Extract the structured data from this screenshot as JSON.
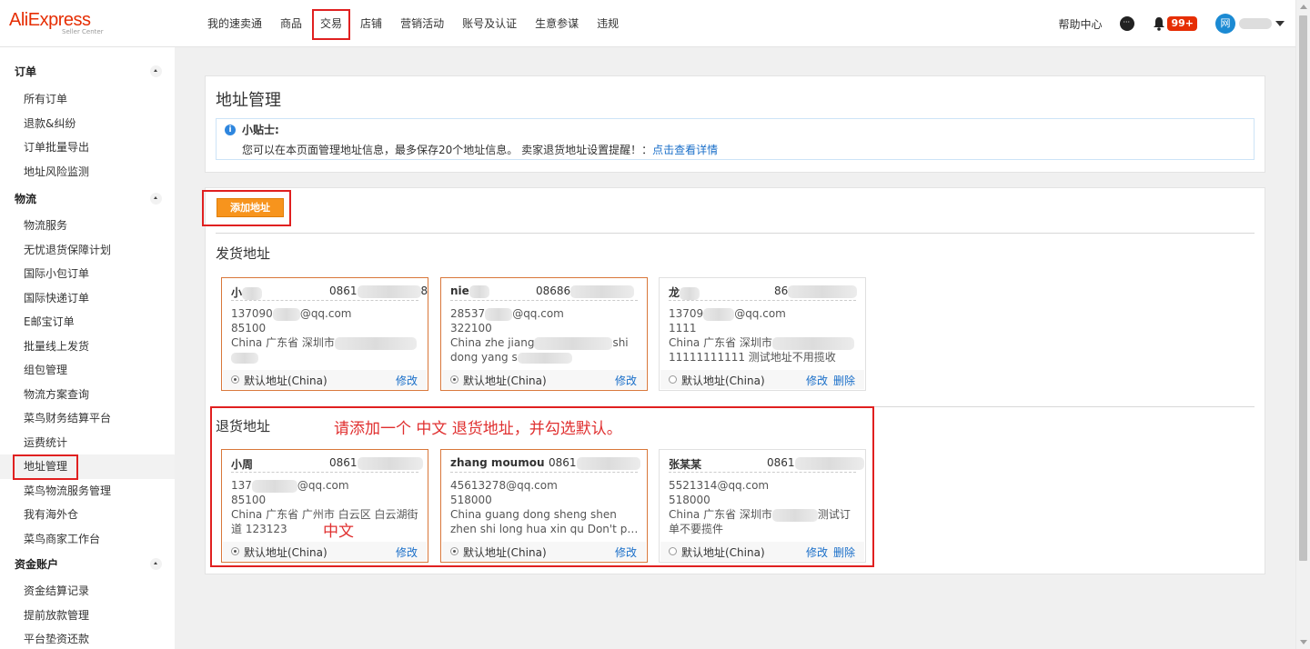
{
  "logo": {
    "brand": "AliExpress",
    "sub": "Seller Center"
  },
  "nav": {
    "items": [
      "我的速卖通",
      "商品",
      "交易",
      "店铺",
      "营销活动",
      "账号及认证",
      "生意参谋",
      "违规"
    ],
    "active_index": 2
  },
  "topright": {
    "help": "帮助中心",
    "badge": "99+",
    "avatar_initial": "网"
  },
  "sidebar": {
    "groups": [
      {
        "title": "订单",
        "items": [
          "所有订单",
          "退款&纠纷",
          "订单批量导出",
          "地址风险监测"
        ]
      },
      {
        "title": "物流",
        "items": [
          "物流服务",
          "无忧退货保障计划",
          "国际小包订单",
          "国际快递订单",
          "E邮宝订单",
          "批量线上发货",
          "组包管理",
          "物流方案查询",
          "菜鸟财务结算平台",
          "运费统计",
          "地址管理",
          "菜鸟物流服务管理",
          "我有海外仓",
          "菜鸟商家工作台"
        ]
      },
      {
        "title": "资金账户",
        "items": [
          "资金结算记录",
          "提前放款管理",
          "平台垫资还款"
        ]
      }
    ],
    "active_item": "地址管理"
  },
  "page": {
    "title": "地址管理",
    "tips_title": "小贴士:",
    "tips_text": "您可以在本页面管理地址信息，最多保存20个地址信息。 卖家退货地址设置提醒！：",
    "tips_link": "点击查看详情",
    "add_button": "添加地址",
    "ship_title": "发货地址",
    "return_title": "退货地址"
  },
  "ship_cards": [
    {
      "name": "小",
      "phone_prefix": "0861",
      "phone_suffix": "8",
      "email_prefix": "137090",
      "email_suffix": "@qq.com",
      "zip": "85100",
      "address_1": "China 广东省 深圳市",
      "address_2": "",
      "default_label": "默认地址(China)",
      "is_default": true,
      "actions": [
        "修改"
      ]
    },
    {
      "name": "nie",
      "phone_prefix": "08686",
      "phone_suffix": "",
      "email_prefix": "28537",
      "email_suffix": "@qq.com",
      "zip": "322100",
      "address_1": "China zhe jiang",
      "address_1_tail": "shi",
      "address_2": "dong yang s",
      "default_label": "默认地址(China)",
      "is_default": true,
      "actions": [
        "修改"
      ]
    },
    {
      "name": "龙",
      "phone_prefix": "86",
      "phone_suffix": "",
      "email_prefix": "13709",
      "email_suffix": "@qq.com",
      "zip": "1111",
      "address_1": "China 广东省 深圳市",
      "address_2": "11111111111 测试地址不用揽收",
      "default_label": "默认地址(China)",
      "is_default": false,
      "actions": [
        "修改",
        "删除"
      ]
    }
  ],
  "return_cards": [
    {
      "name": "小周",
      "phone_prefix": "0861",
      "phone_suffix": "",
      "email_prefix": "137",
      "email_suffix": "@qq.com",
      "zip": "85100",
      "address_1": "China 广东省 广州市 白云区 白云湖街",
      "address_2": "道 123123",
      "default_label": "默认地址(China)",
      "is_default": true,
      "actions": [
        "修改"
      ]
    },
    {
      "name": "zhang moumou",
      "phone_prefix": "0861",
      "phone_suffix": "",
      "email_prefix": "45613278@qq.com",
      "email_suffix": "",
      "zip": "518000",
      "address_1": "China guang dong sheng shen",
      "address_2": "zhen shi long hua xin qu Don't pic...",
      "default_label": "默认地址(China)",
      "is_default": true,
      "actions": [
        "修改"
      ]
    },
    {
      "name": "张某某",
      "phone_prefix": "0861",
      "phone_suffix": "",
      "email_prefix": "5521314@qq.com",
      "email_suffix": "",
      "zip": "518000",
      "address_1": "China 广东省 深圳市",
      "address_1_tail": "测试订",
      "address_2": "单不要揽件",
      "default_label": "默认地址(China)",
      "is_default": false,
      "actions": [
        "修改",
        "删除"
      ]
    }
  ],
  "annotations": {
    "instruction": "请添加一个  中文  退货地址，并勾选默认。",
    "chinese_note": "中文"
  },
  "colors": {
    "brand": "#e62e04",
    "accent_button": "#f7941d",
    "link": "#1a6fc9",
    "highlight_border": "#e02020",
    "card_highlight": "#d9773a"
  }
}
